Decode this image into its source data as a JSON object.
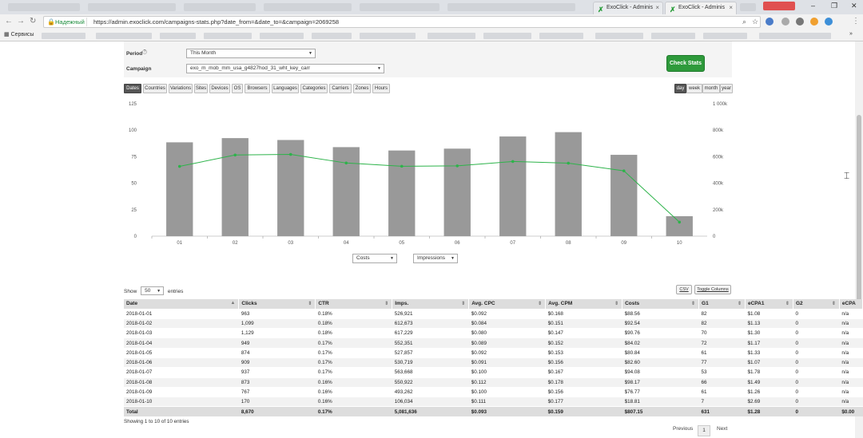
{
  "browser": {
    "tabs": [
      {
        "title": "ExoClick - Adminis",
        "active": false
      },
      {
        "title": "ExoClick - Adminis",
        "active": true
      }
    ],
    "profile_label": "",
    "secure_label": "Надежный",
    "url": "https://admin.exoclick.com/campaigns-stats.php?date_from=&date_to=&campaign=2069258",
    "bookmarks_apps": "Сервисы"
  },
  "filters": {
    "period_label": "Period",
    "period_value": "This Month",
    "campaign_label": "Campaign",
    "campaign_value": "exo_m_mob_mm_usa_g4827hod_31_wht_key_carr",
    "check_button": "Check Stats"
  },
  "breakdown_tabs": [
    "Dates",
    "Countries",
    "Variations",
    "Sites",
    "Devices",
    "OS",
    "Browsers",
    "Languages",
    "Categories",
    "Carriers",
    "Zones",
    "Hours"
  ],
  "breakdown_active": "Dates",
  "granularity_tabs": [
    "day",
    "week",
    "month",
    "year"
  ],
  "granularity_active": "day",
  "chart_data": {
    "type": "bar",
    "categories": [
      "01",
      "02",
      "03",
      "04",
      "05",
      "06",
      "07",
      "08",
      "09",
      "10"
    ],
    "series": [
      {
        "name": "Costs",
        "kind": "bar",
        "axis": "left",
        "color": "#999999",
        "values": [
          88.56,
          92.54,
          90.76,
          84.02,
          80.84,
          82.6,
          94.08,
          98.17,
          76.77,
          18.81
        ]
      },
      {
        "name": "Impressions",
        "kind": "line",
        "axis": "right",
        "color": "#2db34a",
        "values": [
          526921,
          612673,
          617229,
          552351,
          527857,
          530719,
          563668,
          550922,
          493262,
          106034
        ]
      }
    ],
    "ylim_left": [
      0,
      125
    ],
    "yticks_left": [
      "0",
      "25",
      "50",
      "75",
      "100",
      "125"
    ],
    "ylim_right": [
      0,
      1000000
    ],
    "yticks_right": [
      "0",
      "200k",
      "400k",
      "600k",
      "800k",
      "1 000k"
    ],
    "xlabel": "",
    "ylabel": "",
    "grid": false
  },
  "chart_selectors": {
    "left": "Costs",
    "right": "Impressions"
  },
  "table_controls": {
    "show_label": "Show",
    "entries_value": "50",
    "entries_label": "entries",
    "csv_button": "CSV",
    "toggle_button": "Toggle Columns"
  },
  "table": {
    "columns": [
      "Date",
      "Clicks",
      "CTR",
      "Imps.",
      "Avg. CPC",
      "Avg. CPM",
      "Costs",
      "G1",
      "eCPA1",
      "G2",
      "eCPA"
    ],
    "rows": [
      [
        "2018-01-01",
        "963",
        "0.18%",
        "526,921",
        "$0.092",
        "$0.168",
        "$88.56",
        "82",
        "$1.08",
        "0",
        "n/a"
      ],
      [
        "2018-01-02",
        "1,099",
        "0.18%",
        "612,673",
        "$0.084",
        "$0.151",
        "$92.54",
        "82",
        "$1.13",
        "0",
        "n/a"
      ],
      [
        "2018-01-03",
        "1,129",
        "0.18%",
        "617,229",
        "$0.080",
        "$0.147",
        "$90.76",
        "70",
        "$1.30",
        "0",
        "n/a"
      ],
      [
        "2018-01-04",
        "949",
        "0.17%",
        "552,351",
        "$0.089",
        "$0.152",
        "$84.02",
        "72",
        "$1.17",
        "0",
        "n/a"
      ],
      [
        "2018-01-05",
        "874",
        "0.17%",
        "527,857",
        "$0.092",
        "$0.153",
        "$80.84",
        "61",
        "$1.33",
        "0",
        "n/a"
      ],
      [
        "2018-01-06",
        "909",
        "0.17%",
        "530,719",
        "$0.091",
        "$0.156",
        "$82.60",
        "77",
        "$1.07",
        "0",
        "n/a"
      ],
      [
        "2018-01-07",
        "937",
        "0.17%",
        "563,668",
        "$0.100",
        "$0.167",
        "$94.08",
        "53",
        "$1.78",
        "0",
        "n/a"
      ],
      [
        "2018-01-08",
        "873",
        "0.16%",
        "550,922",
        "$0.112",
        "$0.178",
        "$98.17",
        "66",
        "$1.49",
        "0",
        "n/a"
      ],
      [
        "2018-01-09",
        "767",
        "0.16%",
        "493,262",
        "$0.100",
        "$0.156",
        "$76.77",
        "61",
        "$1.26",
        "0",
        "n/a"
      ],
      [
        "2018-01-10",
        "170",
        "0.16%",
        "106,034",
        "$0.111",
        "$0.177",
        "$18.81",
        "7",
        "$2.69",
        "0",
        "n/a"
      ]
    ],
    "total": [
      "Total",
      "8,670",
      "0.17%",
      "5,081,636",
      "$0.093",
      "$0.159",
      "$807.15",
      "631",
      "$1.28",
      "0",
      "$0.00"
    ]
  },
  "table_info": "Showing 1 to 10 of 10 entries",
  "pagination": {
    "previous": "Previous",
    "current": "1",
    "next": "Next"
  }
}
